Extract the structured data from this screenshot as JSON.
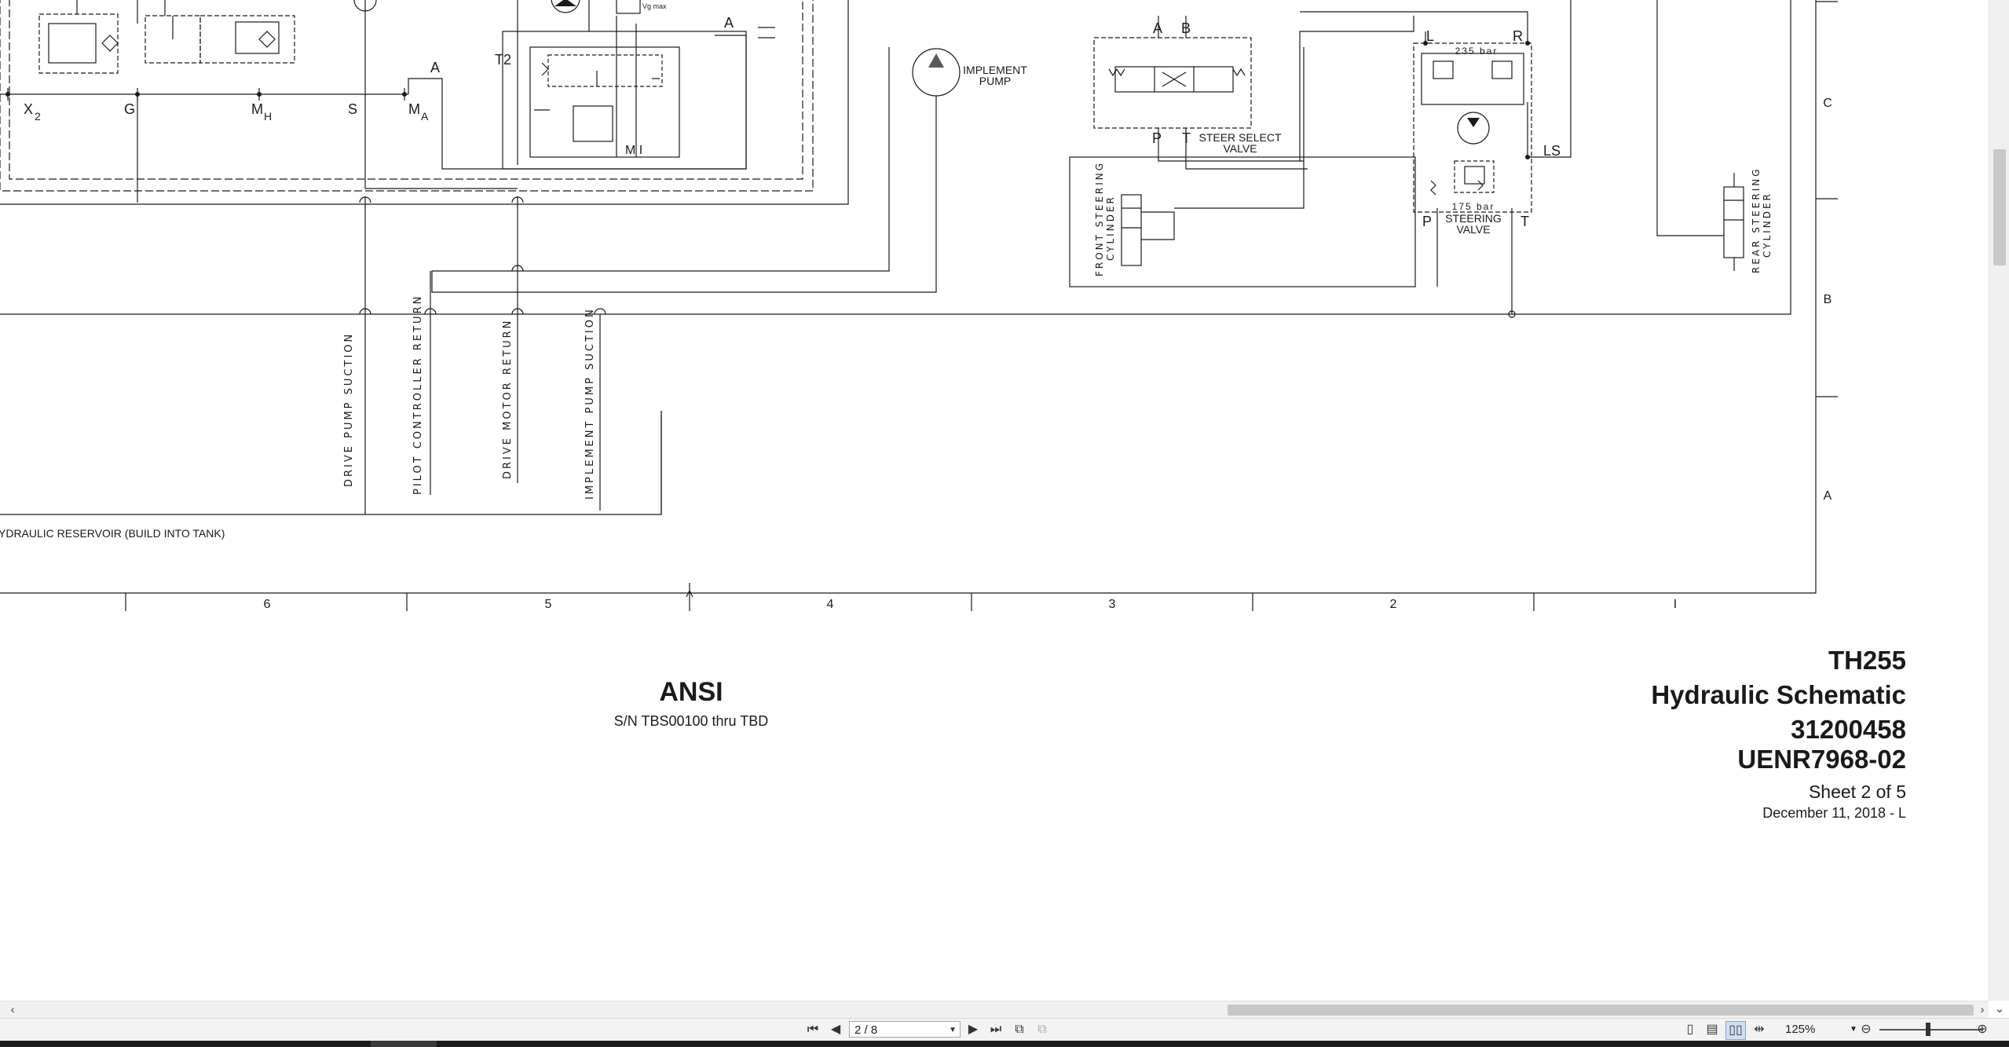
{
  "viewer": {
    "labels": {
      "x2": "X",
      "x2sub": "2",
      "g": "G",
      "mh": "M",
      "mhsub": "H",
      "s": "S",
      "ma": "M",
      "masub": "A",
      "a_left": "A",
      "t2": "T2",
      "a_mid": "A",
      "mi": "M I",
      "vgmax": "Vg max",
      "implement_pump": [
        "IMPLEMENT",
        "PUMP"
      ],
      "steer_a": "A",
      "steer_b": "B",
      "steer_p": "P",
      "steer_t": "T",
      "steer_select_valve": [
        "STEER SELECT",
        "VALVE"
      ],
      "front_steering_cylinder": [
        "FRONT STEERING",
        "CYLINDER"
      ],
      "sv_l": "L",
      "sv_r": "R",
      "sv_235": "235 bar",
      "sv_175": "175 bar",
      "sv_ls": "LS",
      "sv_p": "P",
      "sv_t": "T",
      "steering_valve": [
        "STEERING",
        "VALVE"
      ],
      "rear_steering_cylinder": [
        "REAR STEERING",
        "CYLINDER"
      ],
      "drive_pump_suction": "DRIVE PUMP SUCTION",
      "pilot_controller_return": "PILOT CONTROLLER RETURN",
      "drive_motor_return": "DRIVE MOTOR RETURN",
      "implement_pump_suction": "IMPLEMENT PUMP SUCTION",
      "reservoir": "YDRAULIC RESERVOIR (BUILD INTO TANK)"
    },
    "zones_row": [
      "C",
      "B",
      "A"
    ],
    "zones_col": [
      "6",
      "5",
      "4",
      "3",
      "2",
      "I"
    ],
    "ansi": {
      "title": "ANSI",
      "serial": "S/N TBS00100 thru TBD"
    },
    "title_block": {
      "model": "TH255",
      "drawing_title": "Hydraulic Schematic",
      "part_number": "31200458",
      "doc_number": "UENR7968-02",
      "sheet": "Sheet 2 of 5",
      "date": "December 11, 2018 - L"
    }
  },
  "toolbar": {
    "page_field": "2 / 8",
    "zoom": "125%",
    "zoom_fraction": 0.45
  },
  "colors": {
    "line": "#1a1a1a",
    "toolbar_bg": "#f3f3f3",
    "scroll_thumb": "#c8c8c8"
  }
}
